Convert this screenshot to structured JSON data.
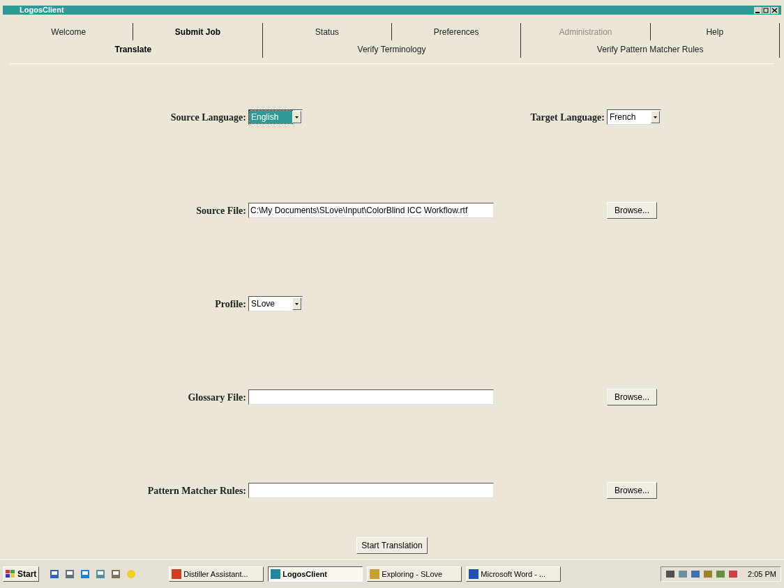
{
  "window": {
    "title": "LogosClient"
  },
  "tabs": [
    {
      "label": "Welcome",
      "selected": false,
      "disabled": false
    },
    {
      "label": "Submit Job",
      "selected": true,
      "disabled": false
    },
    {
      "label": "Status",
      "selected": false,
      "disabled": false
    },
    {
      "label": "Preferences",
      "selected": false,
      "disabled": false
    },
    {
      "label": "Administration",
      "selected": false,
      "disabled": true
    },
    {
      "label": "Help",
      "selected": false,
      "disabled": false
    }
  ],
  "subtabs": [
    {
      "label": "Translate",
      "selected": true
    },
    {
      "label": "Verify Terminology",
      "selected": false
    },
    {
      "label": "Verify Pattern Matcher Rules",
      "selected": false
    }
  ],
  "form": [
    {
      "label": "Source Language:",
      "kind": "select",
      "value": "English",
      "highlighted": true,
      "right": {
        "label": "Target Language:",
        "kind": "select",
        "value": "French",
        "highlighted": false
      }
    },
    {
      "label": "Source File:",
      "kind": "text",
      "value": "C:\\My Documents\\SLove\\Input\\ColorBlind ICC Workflow.rtf",
      "right": {
        "kind": "button",
        "label": "Browse..."
      }
    },
    {
      "label": "Profile:",
      "kind": "select",
      "value": "SLove",
      "highlighted": false
    },
    {
      "label": "Glossary File:",
      "kind": "text",
      "right": {
        "kind": "button",
        "label": "Browse..."
      }
    },
    {
      "label": "Pattern Matcher Rules:",
      "kind": "text",
      "right": {
        "kind": "button",
        "label": "Browse..."
      }
    }
  ],
  "action_button": "Start Translation",
  "taskbar": {
    "start": "Start",
    "tasks": [
      {
        "label": "Distiller Assistant...",
        "selected": false,
        "color": "#d04020"
      },
      {
        "label": "LogosClient",
        "selected": true,
        "color": "#1f8a9a"
      },
      {
        "label": "Exploring - SLove",
        "selected": false,
        "color": "#c8a030"
      },
      {
        "label": "Microsoft Word - ...",
        "selected": false,
        "color": "#2050b0"
      }
    ],
    "clock": "2:05 PM"
  }
}
